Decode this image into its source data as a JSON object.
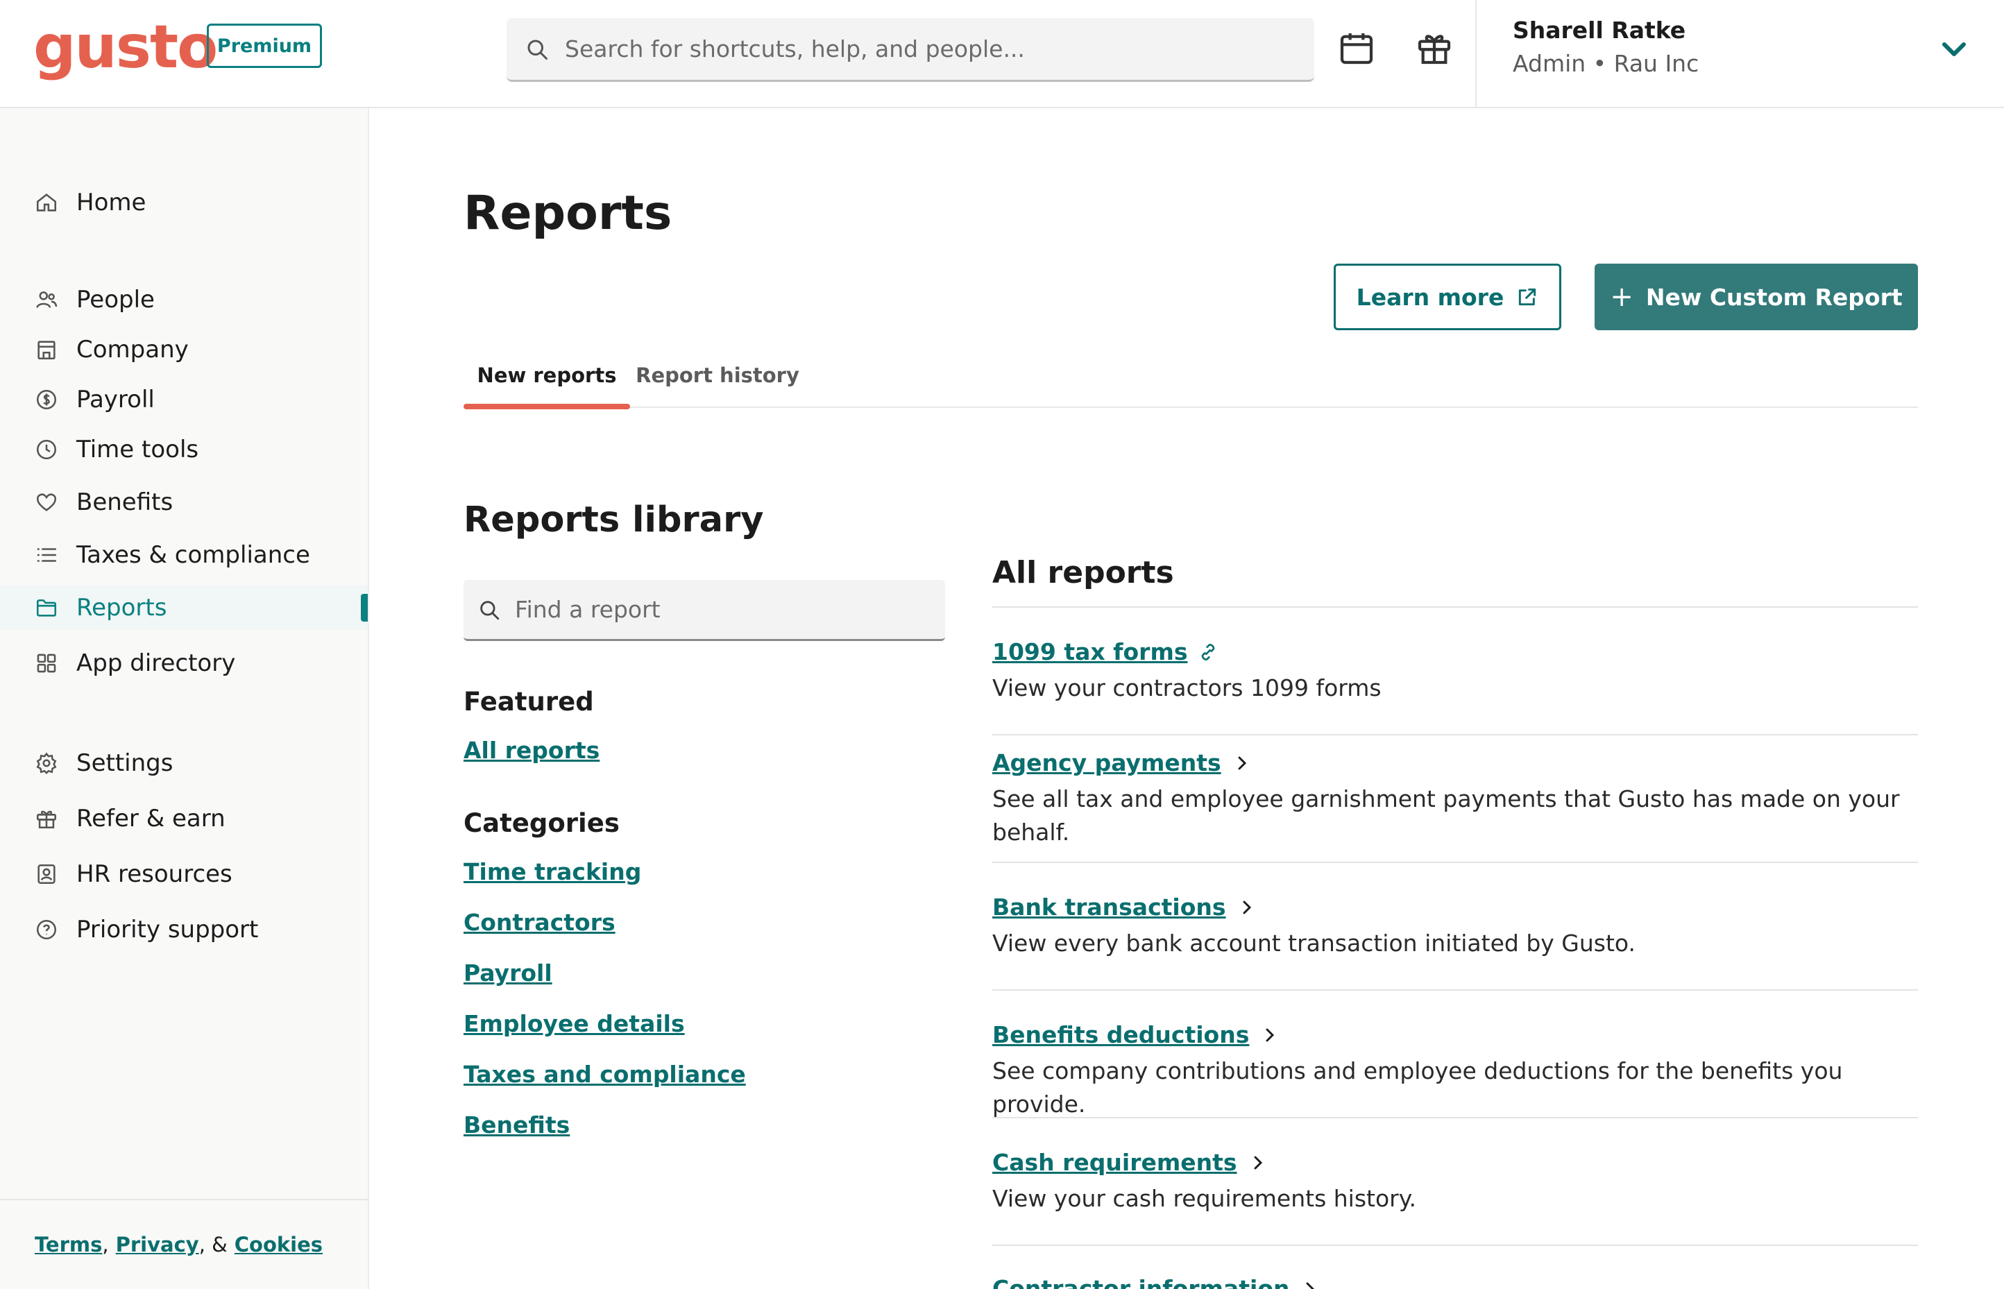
{
  "brand": {
    "logo": "gusto",
    "badge": "Premium",
    "accent": "#e5614f",
    "teal": "#0a6e6e"
  },
  "search": {
    "placeholder": "Search for shortcuts, help, and people..."
  },
  "user": {
    "name": "Sharell Ratke",
    "role": "Admin • Rau Inc"
  },
  "sidebar": {
    "items": [
      {
        "label": "Home",
        "icon": "home-icon"
      },
      {
        "label": "People",
        "icon": "people-icon"
      },
      {
        "label": "Company",
        "icon": "building-icon"
      },
      {
        "label": "Payroll",
        "icon": "dollar-icon"
      },
      {
        "label": "Time tools",
        "icon": "clock-icon"
      },
      {
        "label": "Benefits",
        "icon": "heart-icon"
      },
      {
        "label": "Taxes & compliance",
        "icon": "list-icon"
      },
      {
        "label": "Reports",
        "icon": "folder-icon",
        "active": true
      },
      {
        "label": "App directory",
        "icon": "apps-icon"
      },
      {
        "label": "Settings",
        "icon": "gear-icon"
      },
      {
        "label": "Refer & earn",
        "icon": "gift-icon"
      },
      {
        "label": "HR resources",
        "icon": "person-card-icon"
      },
      {
        "label": "Priority support",
        "icon": "help-icon"
      }
    ],
    "footer": {
      "terms": "Terms",
      "privacy": "Privacy",
      "cookies": "Cookies",
      "sep1": ",",
      "sep2": ", &"
    }
  },
  "main": {
    "title": "Reports",
    "learn_more": "Learn more",
    "new_custom_report": "New Custom Report",
    "tabs": [
      {
        "label": "New reports",
        "active": true
      },
      {
        "label": "Report history"
      }
    ],
    "library": {
      "title": "Reports library",
      "find_placeholder": "Find a report",
      "featured_heading": "Featured",
      "featured_link": "All reports",
      "categories_heading": "Categories",
      "categories": [
        "Time tracking",
        "Contractors",
        "Payroll",
        "Employee details",
        "Taxes and compliance",
        "Benefits"
      ]
    },
    "all_reports": {
      "title": "All reports",
      "items": [
        {
          "name": "1099 tax forms",
          "desc": "View your contractors 1099 forms",
          "icon": "link-icon"
        },
        {
          "name": "Agency payments",
          "desc": "See all tax and employee garnishment payments that Gusto has made on your behalf.",
          "icon": "chevron-right-icon"
        },
        {
          "name": "Bank transactions",
          "desc": "View every bank account transaction initiated by Gusto.",
          "icon": "chevron-right-icon"
        },
        {
          "name": "Benefits deductions",
          "desc": "See company contributions and employee deductions for the benefits you provide.",
          "icon": "chevron-right-icon"
        },
        {
          "name": "Cash requirements",
          "desc": "View your cash requirements history.",
          "icon": "chevron-right-icon"
        },
        {
          "name": "Contractor information",
          "desc": "",
          "icon": "chevron-right-icon"
        }
      ]
    }
  }
}
